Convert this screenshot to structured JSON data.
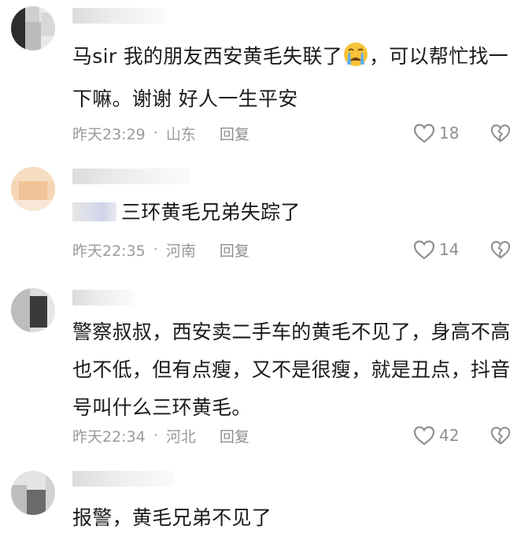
{
  "comments": [
    {
      "text_before_emoji": "马sir  我的朋友西安黄毛失联了",
      "emoji": "crying-face-emoji",
      "text_after_emoji": "，可以帮忙找一下嘛。谢谢 好人一生平安",
      "time": "昨天23:29",
      "location": "山东",
      "reply": "回复",
      "likes": "18"
    },
    {
      "text": "三环黄毛兄弟失踪了",
      "time": "昨天22:35",
      "location": "河南",
      "reply": "回复",
      "likes": "14"
    },
    {
      "text": "警察叔叔，西安卖二手车的黄毛不见了，身高不高也不低，但有点瘦，又不是很瘦，就是丑点，抖音号叫什么三环黄毛。",
      "time": "昨天22:34",
      "location": "河北",
      "reply": "回复",
      "likes": "42"
    },
    {
      "text": "报警，黄毛兄弟不见了"
    }
  ],
  "separator": "·",
  "colors": {
    "meta_gray": "#9a9a9a",
    "text": "#1a1a1a",
    "background": "#ffffff"
  },
  "icons": [
    "heart-outline-icon",
    "broken-heart-icon",
    "crying-face-emoji"
  ]
}
